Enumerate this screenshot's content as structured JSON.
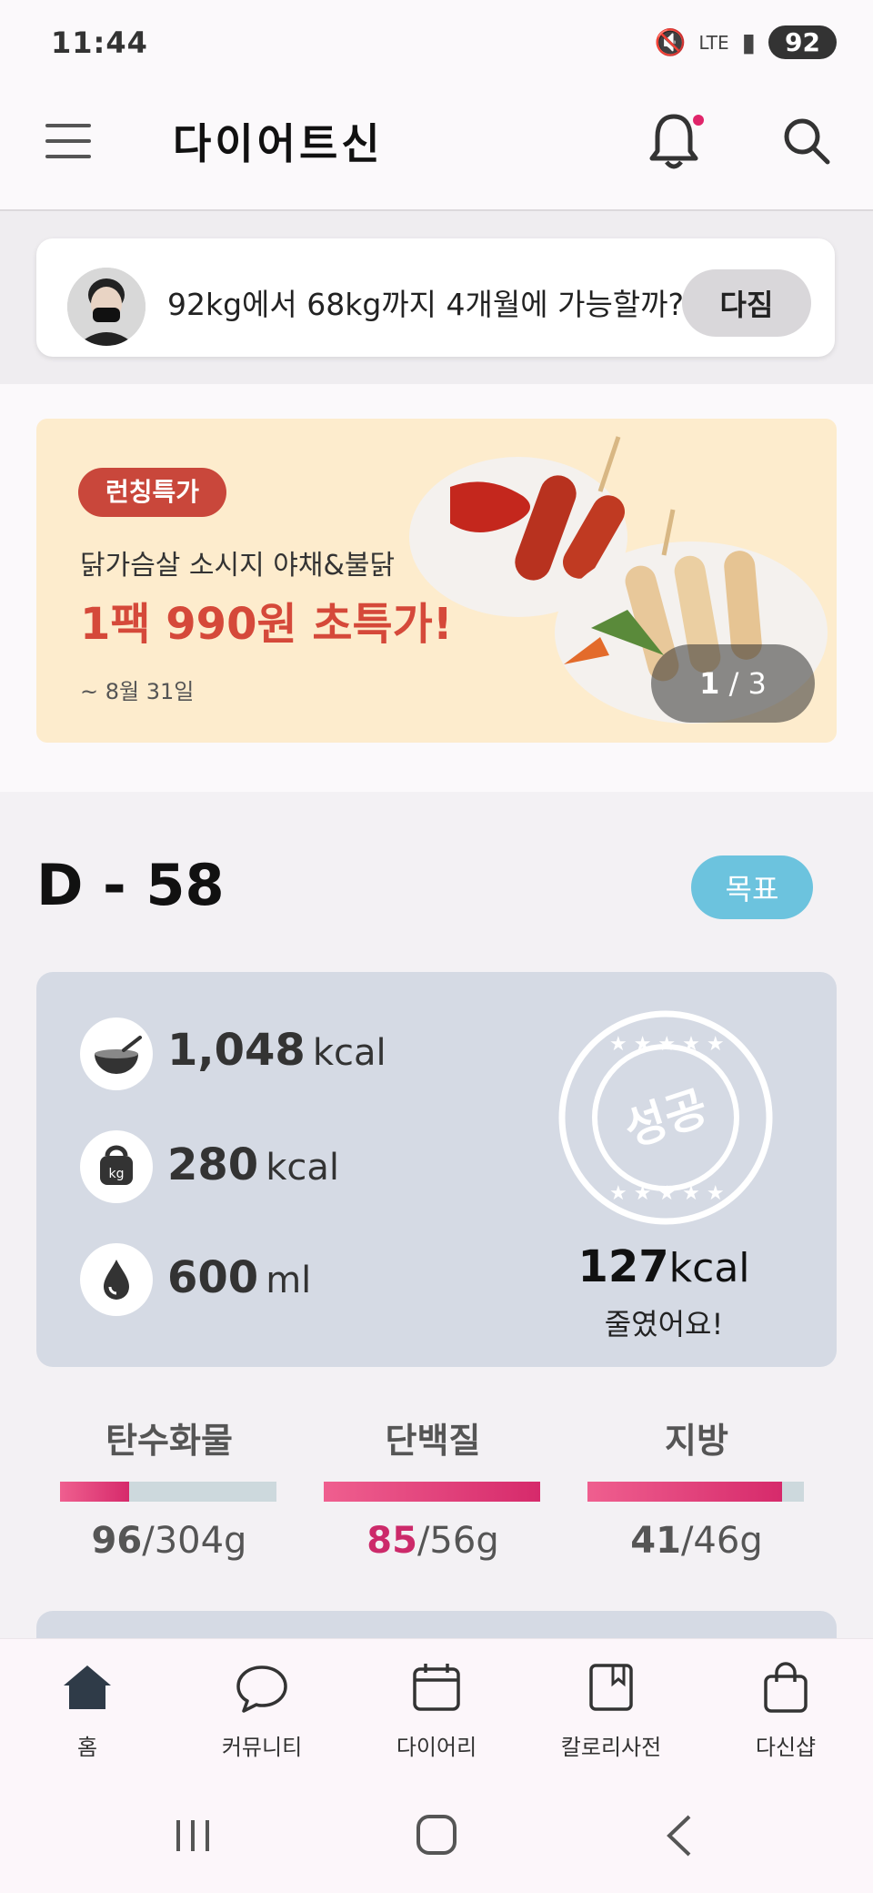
{
  "status_bar": {
    "time": "11:44",
    "network": "LTE",
    "battery": "92"
  },
  "header": {
    "logo": "다이어트신"
  },
  "pledge": {
    "text": "92kg에서 68kg까지 4개월에 가능할까?",
    "button": "다짐"
  },
  "banner": {
    "badge": "런칭특가",
    "subtitle": "닭가슴살 소시지 야채&불닭",
    "headline": "1팩 990원 초특가!",
    "date": "~ 8월 31일",
    "pager_current": "1",
    "pager_total": "/ 3"
  },
  "dday": {
    "label": "D - 58",
    "goal_button": "목표"
  },
  "stats": {
    "food": {
      "value": "1,048",
      "unit": "kcal",
      "icon": "bowl-icon"
    },
    "exercise": {
      "value": "280",
      "unit": "kcal",
      "icon": "kettlebell-icon"
    },
    "water": {
      "value": "600",
      "unit": "ml",
      "icon": "water-drop-icon"
    },
    "stamp_text": "성공",
    "saved_value": "127",
    "saved_unit": "kcal",
    "saved_sub": "줄였어요!"
  },
  "nutrients": [
    {
      "name": "탄수화물",
      "current": "96",
      "total": "/304g",
      "progress": 0.32
    },
    {
      "name": "단백질",
      "current": "85",
      "total": "/56g",
      "progress": 1.0
    },
    {
      "name": "지방",
      "current": "41",
      "total": "/46g",
      "progress": 0.9
    }
  ],
  "bottom_nav": [
    {
      "label": "홈",
      "icon": "home-icon"
    },
    {
      "label": "커뮤니티",
      "icon": "chat-bubble-icon"
    },
    {
      "label": "다이어리",
      "icon": "calendar-icon"
    },
    {
      "label": "칼로리사전",
      "icon": "book-icon"
    },
    {
      "label": "다신샵",
      "icon": "shopping-bag-icon"
    }
  ],
  "colors": {
    "accent": "#d62a6b",
    "goal": "#6cc3de",
    "card": "#d5dae4",
    "banner": "#fdeccd"
  }
}
